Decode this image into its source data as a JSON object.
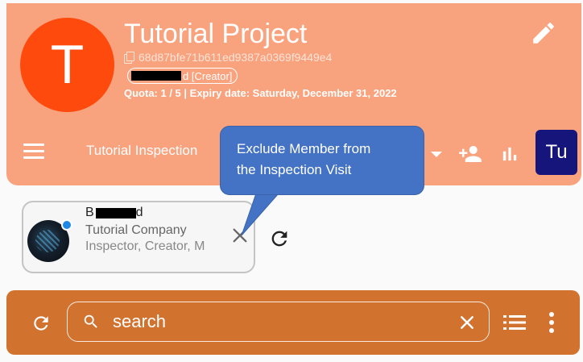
{
  "project": {
    "avatar_letter": "T",
    "title": "Tutorial Project",
    "id": "68d87bfe71b611ed9387a0369f9449e4",
    "owner_suffix": "d [Creator]",
    "quota": "Quota: 1 / 5 | Expiry date: Saturday, December 31, 2022"
  },
  "toolbar": {
    "inspection_name": "Tutorial Inspection",
    "user_initials": "Tu"
  },
  "tooltip": {
    "line1": "Exclude Member from",
    "line2": "the Inspection Visit"
  },
  "member": {
    "name_prefix": "B",
    "name_suffix": "d",
    "company": "Tutorial Company",
    "roles": "Inspector, Creator, M"
  },
  "search": {
    "placeholder": "search"
  },
  "colors": {
    "header_bg": "#F9A27E",
    "project_avatar": "#FF4A0D",
    "user_avatar": "#15157C",
    "tooltip_bg": "#4472C4",
    "search_bar_bg": "#D2722F",
    "online_dot": "#1E88E5"
  },
  "icons": [
    "copy-icon",
    "edit-icon",
    "menu-icon",
    "chevron-down-icon",
    "add-member-icon",
    "chart-icon",
    "close-icon",
    "refresh-icon",
    "search-icon",
    "list-icon",
    "more-vert-icon"
  ]
}
